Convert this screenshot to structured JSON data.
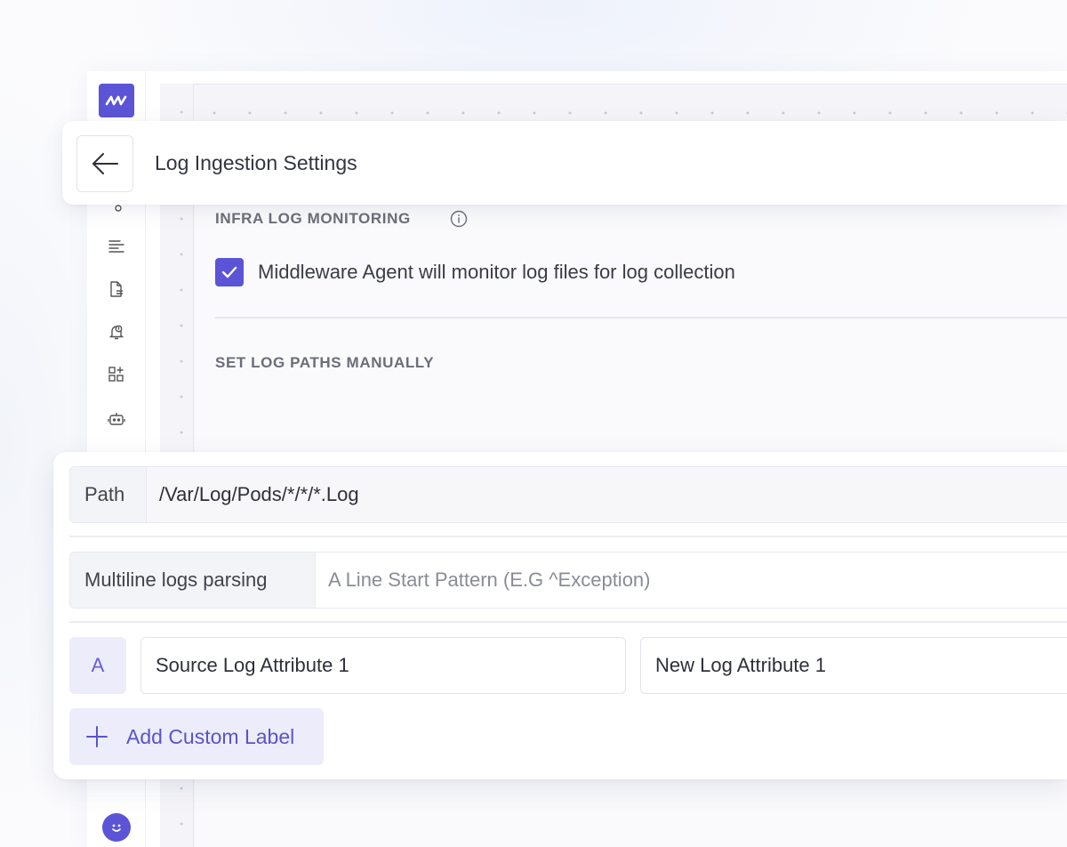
{
  "header": {
    "title": "Log Ingestion Settings"
  },
  "sidebar": {
    "items": [
      {
        "icon": "logo-icon"
      },
      {
        "icon": "logs-icon"
      },
      {
        "icon": "list-filter-icon"
      },
      {
        "icon": "document-icon"
      },
      {
        "icon": "alert-bell-icon"
      },
      {
        "icon": "dashboard-add-icon"
      },
      {
        "icon": "bot-icon"
      }
    ],
    "avatar_icon": "smiley-avatar-icon"
  },
  "infra": {
    "title": "INFRA LOG MONITORING",
    "checkbox_label": "Middleware Agent will monitor log files for log collection",
    "checked": true
  },
  "manual_paths": {
    "title": "SET LOG PATHS MANUALLY"
  },
  "form": {
    "path_label": "Path",
    "path_value": "/Var/Log/Pods/*/*/*.Log",
    "multiline_label": "Multiline logs parsing",
    "multiline_placeholder": "A Line Start Pattern (E.G ^Exception)",
    "attribute_badge": "A",
    "source_attribute": "Source Log Attribute 1",
    "new_attribute": "New Log Attribute 1",
    "add_label_button": "Add Custom Label"
  },
  "colors": {
    "accent": "#5b54d6",
    "accent_light": "#ececfb"
  }
}
